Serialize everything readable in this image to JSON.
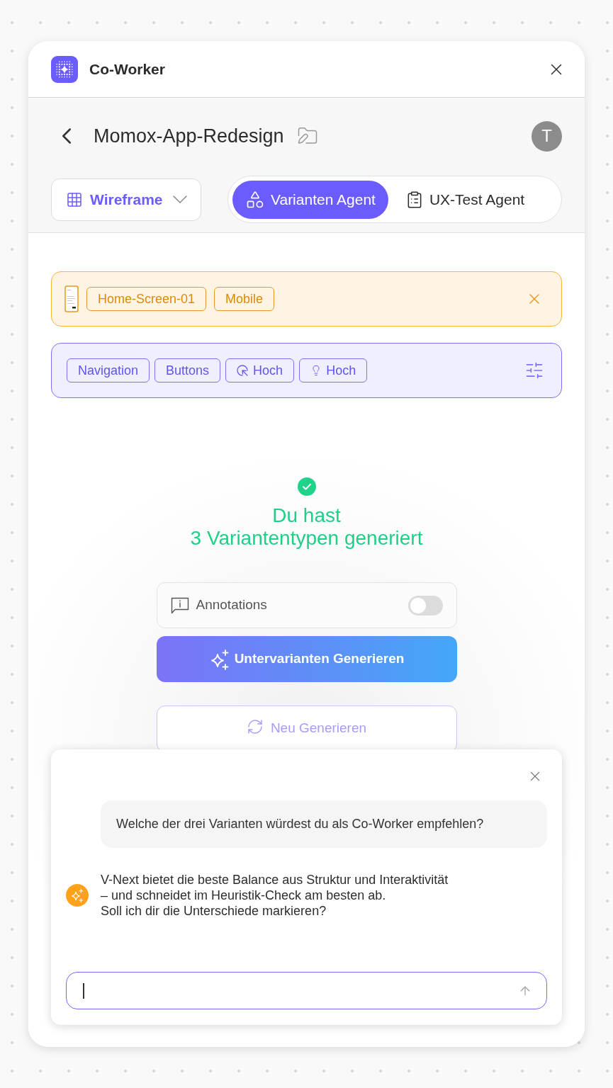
{
  "header": {
    "title": "Co-Worker"
  },
  "project": {
    "title": "Momox-App-Redesign",
    "avatar": "T"
  },
  "view_dropdown": {
    "label": "Wireframe"
  },
  "agent_tabs": [
    {
      "label": "Varianten Agent",
      "selected": true,
      "kind": "shapes"
    },
    {
      "label": "UX-Test Agent",
      "selected": false,
      "kind": "clipboard"
    }
  ],
  "screen_context": {
    "tags": [
      "Home-Screen-01",
      "Mobile"
    ]
  },
  "filters": {
    "tags": [
      {
        "label": "Navigation",
        "kind": "plain"
      },
      {
        "label": "Buttons",
        "kind": "plain"
      },
      {
        "label": "Hoch",
        "kind": "cursor"
      },
      {
        "label": "Hoch",
        "kind": "bulb"
      }
    ]
  },
  "status": {
    "title": "Du hast\n3 Variantentypen generiert"
  },
  "annotations": {
    "label": "Annotations",
    "on": false
  },
  "actions": [
    {
      "label": "Untervarianten Generieren",
      "kind": "primary"
    },
    {
      "label": "Neu Generieren",
      "kind": "secondary"
    }
  ],
  "chat": {
    "messages": [
      {
        "kind": "question",
        "text": "Welche der drei Varianten würdest du als Co-Worker empfehlen?"
      },
      {
        "kind": "answer",
        "text": "V-Next bietet die beste Balance aus Struktur und Interaktivität\n– und schneidet im Heuristik-Check am besten ab.\nSoll ich dir die Unterschiede markieren?"
      }
    ]
  }
}
